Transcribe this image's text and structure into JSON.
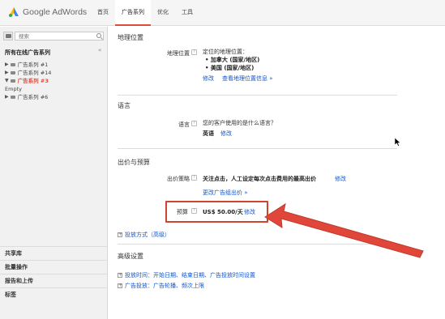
{
  "header": {
    "logo_text": "Google AdWords",
    "nav": [
      "首页",
      "广告系列",
      "优化",
      "工具"
    ],
    "active_nav": 1
  },
  "sidebar": {
    "search_placeholder": "搜索",
    "collapse": "«",
    "tree_head": "所有在线广告系列",
    "items": [
      {
        "label": "广告系列 #1",
        "selected": false
      },
      {
        "label": "广告系列 #14",
        "selected": false
      },
      {
        "label": "广告系列 #3",
        "selected": true
      },
      {
        "label": "Empty",
        "selected": false
      },
      {
        "label": "广告系列 #6",
        "selected": false
      }
    ],
    "links": [
      "共享库",
      "批量操作",
      "报告和上传",
      "标签"
    ]
  },
  "main": {
    "location": {
      "title": "地理位置",
      "label": "地理位置",
      "help": "?",
      "heading": "定位的地理位置：",
      "values": [
        "• 加拿大 (国家/地区)",
        "• 美国 (国家/地区)"
      ],
      "edit": "修改",
      "more": "查看地理位置信息 »"
    },
    "language": {
      "title": "语言",
      "label": "语言",
      "help": "?",
      "question": "您的客户使用的是什么语言？",
      "value": "英语",
      "edit": "修改"
    },
    "bidding": {
      "title": "出价与预算",
      "strategy_label": "出价策略",
      "help": "?",
      "strategy_value": "关注点击，人工设定每次点击费用的最高出价",
      "strategy_edit": "修改",
      "more_options": "更改广告组出价 »",
      "budget_label": "预算",
      "budget_value": "US$ 50.00/天",
      "budget_edit": "修改",
      "delivery": "投放方式（高级）",
      "plus": "⊞"
    },
    "advanced": {
      "title": "高级设置",
      "items": [
        "投放时间：开始日期、结束日期、广告投放时间设置",
        "广告投放：广告轮播、频次上限"
      ]
    }
  },
  "colors": {
    "accent_red": "#d0432c",
    "link_blue": "#1155cc",
    "header_bg": "#f5f5f5"
  }
}
